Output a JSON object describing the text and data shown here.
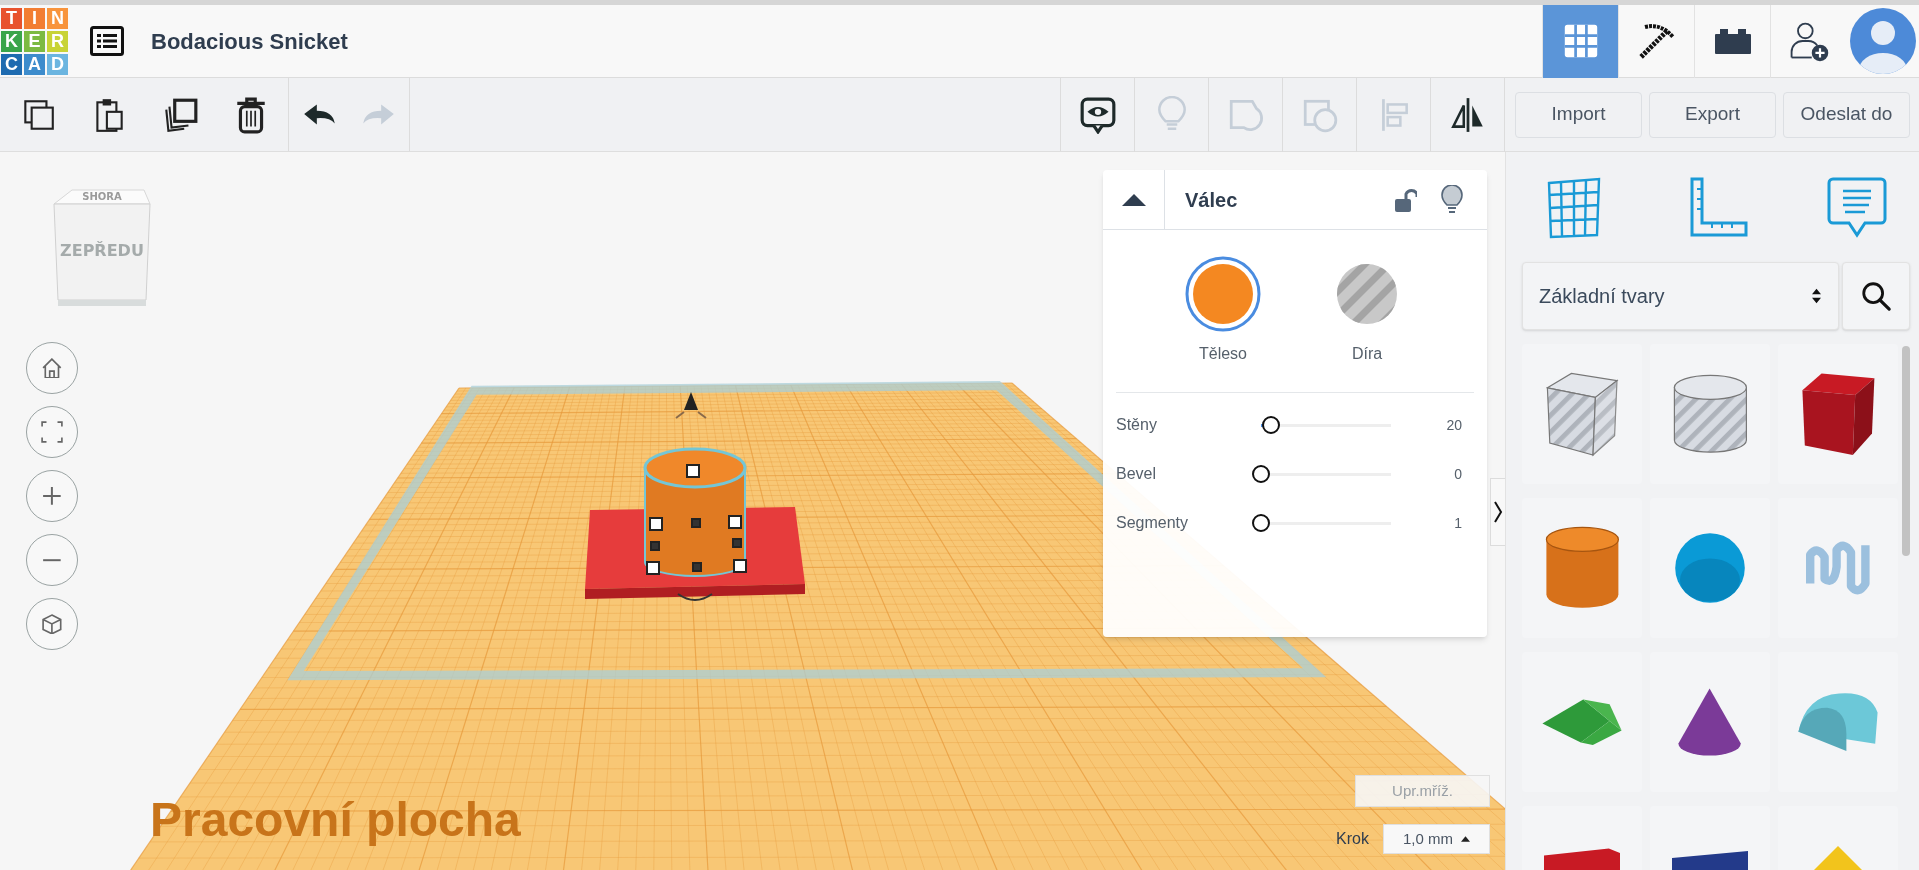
{
  "logo": {
    "letters": [
      {
        "char": "T",
        "color": "#e8522d"
      },
      {
        "char": "I",
        "color": "#f27d32"
      },
      {
        "char": "N",
        "color": "#f8943c"
      },
      {
        "char": "K",
        "color": "#3aa54a"
      },
      {
        "char": "E",
        "color": "#7cba42"
      },
      {
        "char": "R",
        "color": "#c8d336"
      },
      {
        "char": "C",
        "color": "#1e6bb0"
      },
      {
        "char": "A",
        "color": "#3d8ccc"
      },
      {
        "char": "D",
        "color": "#6bb5e0"
      }
    ]
  },
  "app": {
    "title": "Bodacious Snicket"
  },
  "view_modes": [
    {
      "kind": "grid",
      "selected": true
    },
    {
      "kind": "pickaxe",
      "selected": false
    },
    {
      "kind": "brick",
      "selected": false
    }
  ],
  "toolbar": {
    "edit_tools": [
      {
        "kind": "copy",
        "disabled": false
      },
      {
        "kind": "paste",
        "disabled": false
      },
      {
        "kind": "duplicate",
        "disabled": false
      },
      {
        "kind": "delete",
        "disabled": false
      }
    ],
    "history_tools": [
      {
        "kind": "undo",
        "disabled": false
      },
      {
        "kind": "redo",
        "disabled": true
      }
    ],
    "shape_tools": [
      {
        "kind": "notes",
        "disabled": false
      },
      {
        "kind": "bulb",
        "disabled": true
      },
      {
        "kind": "group",
        "disabled": true
      },
      {
        "kind": "ungroup",
        "disabled": true
      },
      {
        "kind": "align",
        "disabled": true
      },
      {
        "kind": "mirror",
        "disabled": false
      }
    ],
    "buttons": [
      "Import",
      "Export",
      "Odeslat do"
    ]
  },
  "viewcube": {
    "top": "SHORA",
    "front": "ZEPŘEDU"
  },
  "view_controls": [
    {
      "kind": "home"
    },
    {
      "kind": "fit"
    },
    {
      "kind": "zoom_in"
    },
    {
      "kind": "zoom_out"
    },
    {
      "kind": "ortho"
    }
  ],
  "workplane": {
    "label": "Pracovní plocha"
  },
  "inspector": {
    "title": "Válec",
    "locked": false,
    "modes": [
      {
        "kind": "solid",
        "label": "Těleso",
        "selected": true
      },
      {
        "kind": "hole",
        "label": "Díra",
        "selected": false
      }
    ],
    "params": [
      {
        "label": "Stěny",
        "level": 0.08,
        "reading": "20"
      },
      {
        "label": "Bevel",
        "level": 0,
        "reading": "0"
      },
      {
        "label": "Segmenty",
        "level": 0,
        "reading": "1"
      }
    ]
  },
  "grid_controls": {
    "edit_grid": "Upr.mříž.",
    "snap_label": "Krok",
    "snap_value": "1,0 mm"
  },
  "library": {
    "tools": [
      {
        "kind": "workplane"
      },
      {
        "kind": "ruler"
      },
      {
        "kind": "notes"
      }
    ],
    "category": "Základní tvary",
    "shapes": [
      {
        "kind": "box_hole"
      },
      {
        "kind": "cylinder_hole"
      },
      {
        "kind": "box"
      },
      {
        "kind": "cylinder"
      },
      {
        "kind": "sphere"
      },
      {
        "kind": "scribble"
      },
      {
        "kind": "roof"
      },
      {
        "kind": "cone"
      },
      {
        "kind": "round_roof"
      },
      {
        "kind": "text"
      },
      {
        "kind": "wedge"
      },
      {
        "kind": "pyramid"
      }
    ]
  }
}
